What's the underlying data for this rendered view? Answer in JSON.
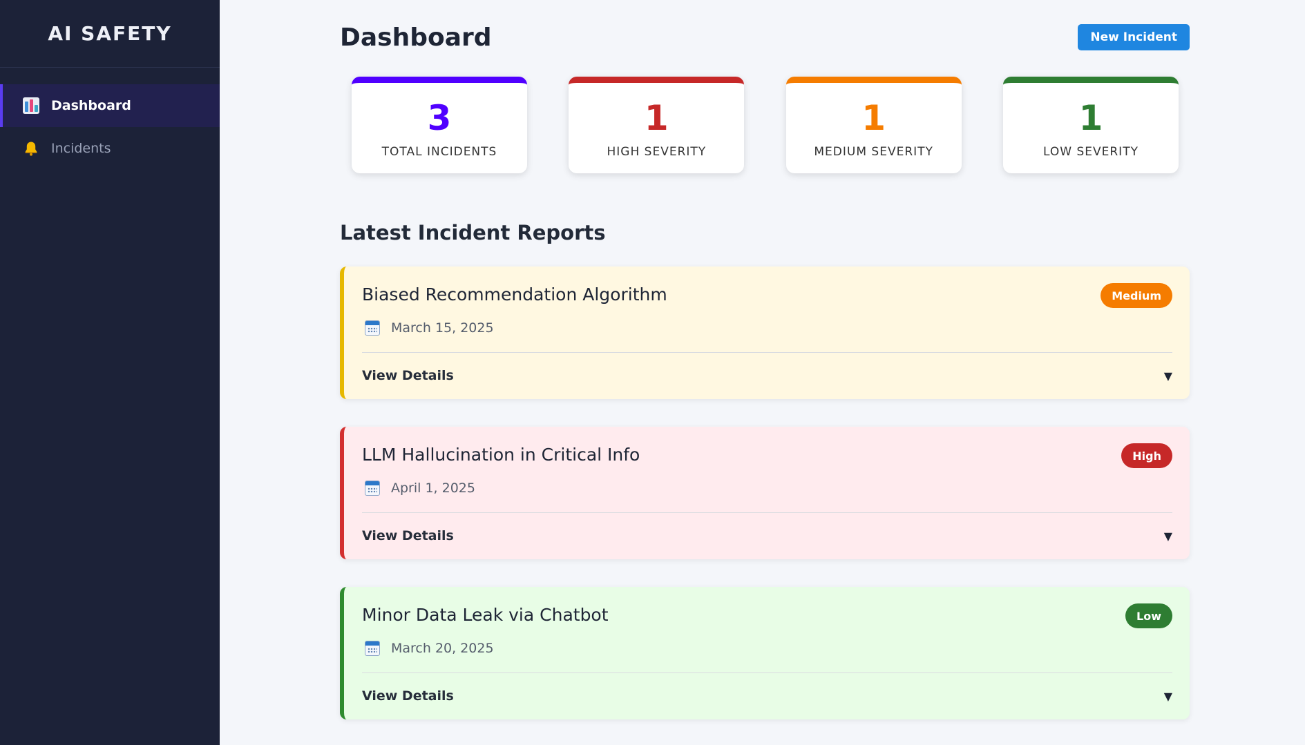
{
  "app": {
    "brand": "AI SAFETY"
  },
  "sidebar": {
    "items": [
      {
        "label": "Dashboard",
        "icon": "bar-chart-icon",
        "active": true
      },
      {
        "label": "Incidents",
        "icon": "bell-icon",
        "active": false
      }
    ]
  },
  "header": {
    "title": "Dashboard",
    "new_button": "New Incident"
  },
  "stats": [
    {
      "value": "3",
      "label": "TOTAL INCIDENTS",
      "color": "#5000ff"
    },
    {
      "value": "1",
      "label": "HIGH SEVERITY",
      "color": "#c62828"
    },
    {
      "value": "1",
      "label": "MEDIUM SEVERITY",
      "color": "#f57c00"
    },
    {
      "value": "1",
      "label": "LOW SEVERITY",
      "color": "#2e7d32"
    }
  ],
  "section": {
    "title": "Latest Incident Reports"
  },
  "incidents": [
    {
      "title": "Biased Recommendation Algorithm",
      "date": "March 15, 2025",
      "severity": "Medium",
      "details_label": "View Details",
      "bg": "#fff8e1",
      "border": "#e6b800",
      "badge_color": "#f57c00"
    },
    {
      "title": "LLM Hallucination in Critical Info",
      "date": "April 1, 2025",
      "severity": "High",
      "details_label": "View Details",
      "bg": "#ffebee",
      "border": "#d32f2f",
      "badge_color": "#c62828"
    },
    {
      "title": "Minor Data Leak via Chatbot",
      "date": "March 20, 2025",
      "severity": "Low",
      "details_label": "View Details",
      "bg": "#e8fde6",
      "border": "#2e8b2e",
      "badge_color": "#2e7d32"
    }
  ]
}
